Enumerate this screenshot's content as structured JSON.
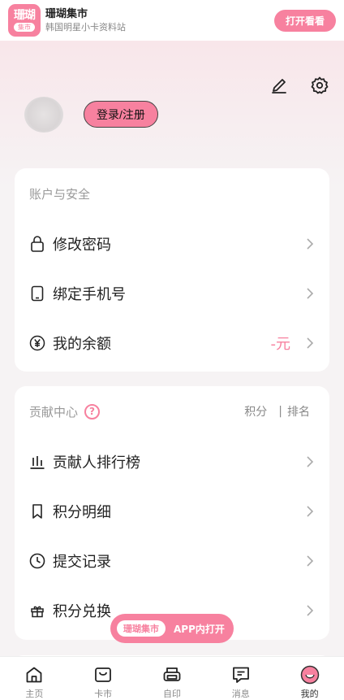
{
  "banner": {
    "logo_top": "珊瑚",
    "logo_bottom": "集市",
    "title": "珊瑚集市",
    "subtitle": "韩国明星小卡资料站",
    "open_button": "打开看看"
  },
  "header": {
    "edit_icon": "pencil-icon",
    "settings_icon": "gear-icon",
    "login_button": "登录/注册"
  },
  "account_section": {
    "title": "账户与安全",
    "items": [
      {
        "label": "修改密码",
        "icon": "lock-icon"
      },
      {
        "label": "绑定手机号",
        "icon": "phone-icon"
      },
      {
        "label": "我的余额",
        "icon": "yen-icon",
        "value": "-元"
      }
    ]
  },
  "contribution_section": {
    "title": "贡献中心",
    "help": "?",
    "points_tab": "积分",
    "rank_tab": "排名",
    "separator": "|",
    "items": [
      {
        "label": "贡献人排行榜",
        "icon": "bar-chart-icon"
      },
      {
        "label": "积分明细",
        "icon": "bookmark-icon"
      },
      {
        "label": "提交记录",
        "icon": "clock-icon"
      },
      {
        "label": "积分兑换",
        "icon": "gift-icon"
      }
    ]
  },
  "floating_pill": {
    "brand": "珊瑚集市",
    "text": "APP内打开"
  },
  "bottom_nav": [
    {
      "label": "主页",
      "icon": "home-icon"
    },
    {
      "label": "卡市",
      "icon": "bag-icon"
    },
    {
      "label": "自印",
      "icon": "printer-icon"
    },
    {
      "label": "消息",
      "icon": "message-icon"
    },
    {
      "label": "我的",
      "icon": "profile-face-icon",
      "active": true
    }
  ],
  "colors": {
    "accent": "#f7819f",
    "muted_text": "#999999",
    "background": "#f6f3f4"
  }
}
